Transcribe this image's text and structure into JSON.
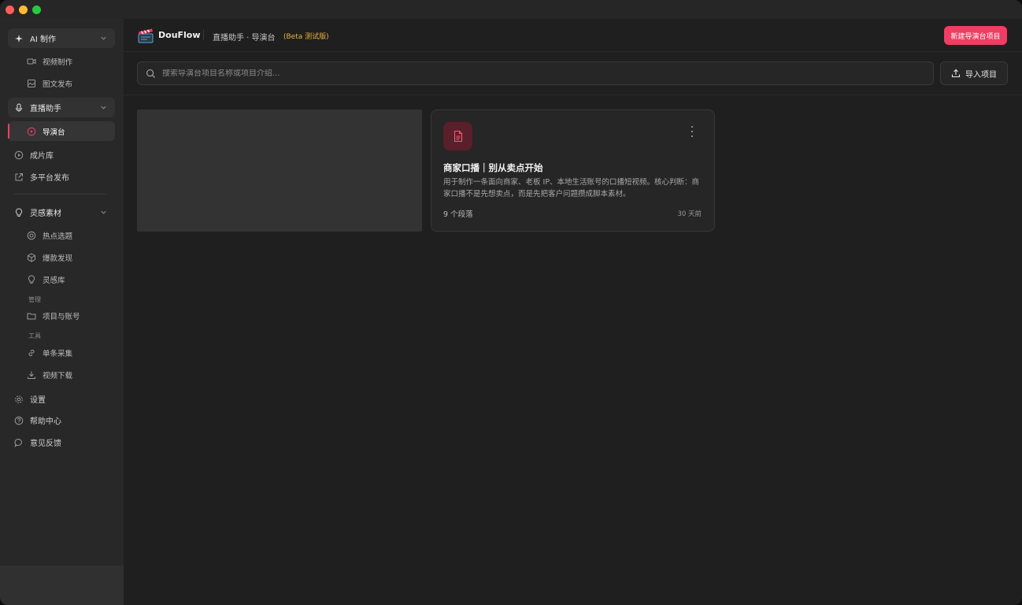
{
  "sidebar": {
    "groups": [
      {
        "label": "AI 制作",
        "icon": "sparkle-icon"
      },
      {
        "label": "直播助手",
        "icon": "microphone-icon"
      },
      {
        "label": "灵感素材",
        "icon": "lightbulb-icon"
      }
    ],
    "items": {
      "video_production": "视频制作",
      "image_post": "图文发布",
      "director": "导演台",
      "film_library": "成片库",
      "multi_publish": "多平台发布",
      "hot_topics": "热点选题",
      "viral_discovery": "爆款发现",
      "inspiration_library": "灵感库",
      "projects_accounts": "项目与账号",
      "single_collect": "单条采集",
      "video_download": "视频下载",
      "settings": "设置",
      "help": "帮助中心",
      "feedback": "意见反馈"
    },
    "sections": {
      "manage": "管理",
      "tools": "工具"
    }
  },
  "header": {
    "brand": "DouFlow",
    "breadcrumb": "直播助手 · 导演台",
    "beta": "(Beta 测试版)",
    "new_button": "新建导演台项目"
  },
  "search": {
    "placeholder": "搜索导演台项目名称或项目介绍...",
    "value": "",
    "import_button": "导入项目"
  },
  "project_card": {
    "title": "商家口播｜别从卖点开始",
    "description": "用于制作一条面向商家、老板 IP、本地生活账号的口播短视频。核心判断：商家口播不是先想卖点，而是先把客户问题攒成脚本素材。",
    "segments": "9 个段落",
    "time": "30 天前"
  },
  "colors": {
    "accent": "#ef3e63",
    "beta": "#e8b23c",
    "sidebar_bg": "#282828",
    "main_bg": "#1f1f1f"
  }
}
